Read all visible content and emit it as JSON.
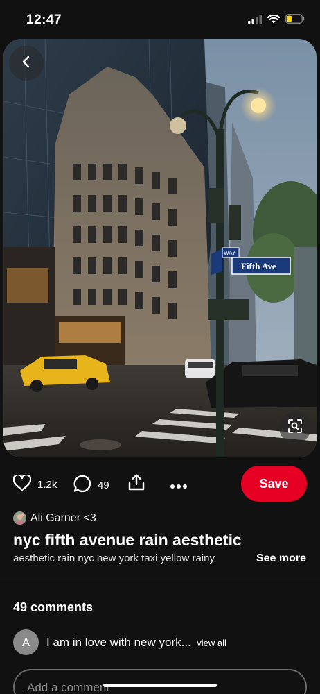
{
  "status_bar": {
    "time": "12:47",
    "icons": [
      "cellular-signal-icon",
      "wifi-icon",
      "battery-low-icon"
    ],
    "battery_color": "#ffd60a"
  },
  "pin": {
    "image_sign_text": "Fifth Ave",
    "image_sign_partial": "WAY",
    "back_icon": "chevron-left-icon",
    "lens_icon": "visual-search-icon"
  },
  "actions": {
    "likes": "1.2k",
    "comments": "49",
    "share_icon": "share-icon",
    "more_icon": "more-icon",
    "save_label": "Save",
    "save_color": "#e60023"
  },
  "creator": {
    "name": "Ali Garner <3"
  },
  "title": "nyc fifth avenue rain aesthetic",
  "description": "aesthetic rain nyc new york taxi yellow rainy",
  "see_more_label": "See more",
  "comments": {
    "count_label": "49 comments",
    "preview": {
      "avatar_initial": "A",
      "text": "I am in love with new york...",
      "view_all_label": "view all"
    },
    "input_placeholder": "Add a comment"
  }
}
